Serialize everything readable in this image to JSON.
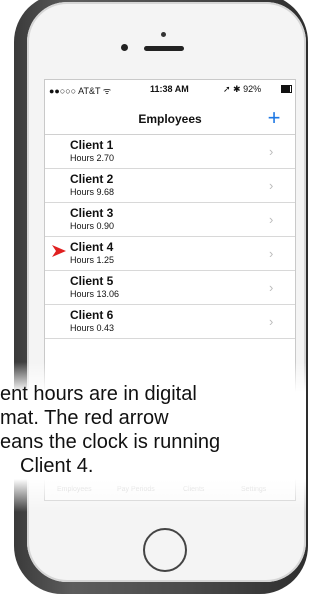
{
  "status_bar": {
    "carrier": "●●○○○ AT&T ᯤ",
    "time": "11:38 AM",
    "right": "➚ ✱ 92%",
    "battery_level": 0.92
  },
  "nav": {
    "title": "Employees",
    "add_label": "+"
  },
  "employees": [
    {
      "name": "Client 1",
      "hours": "Hours 2.70",
      "running": false
    },
    {
      "name": "Client 2",
      "hours": "Hours 9.68",
      "running": false
    },
    {
      "name": "Client 3",
      "hours": "Hours 0.90",
      "running": false
    },
    {
      "name": "Client 4",
      "hours": "Hours 1.25",
      "running": true
    },
    {
      "name": "Client 5",
      "hours": "Hours 13.06",
      "running": false
    },
    {
      "name": "Client 6",
      "hours": "Hours 0.43",
      "running": false
    }
  ],
  "tabs": [
    "Employees",
    "Pay Periods",
    "Clients",
    "Settings"
  ],
  "caption_lines": [
    "ent hours are in digital",
    "mat. The red arrow",
    "eans the clock is running",
    "Client 4."
  ],
  "colors": {
    "accent": "#1e78e4",
    "running_arrow": "#e02020"
  }
}
